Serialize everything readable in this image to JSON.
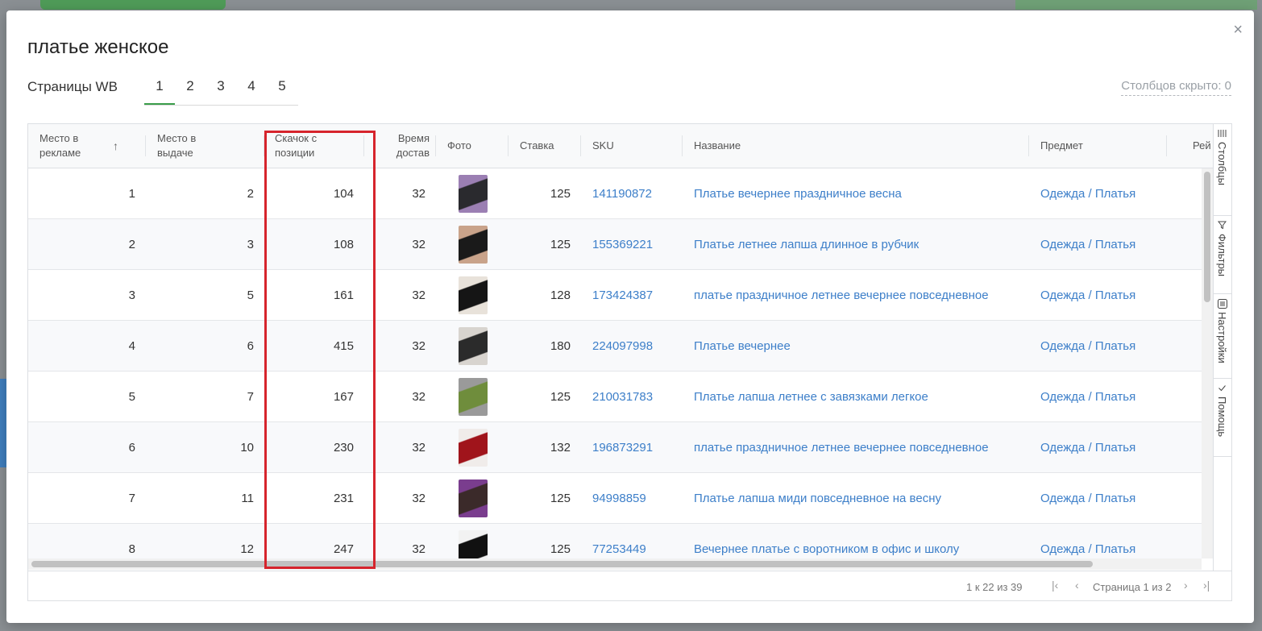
{
  "modal": {
    "title": "платье женское",
    "close_icon": "×",
    "pages_label": "Страницы WB",
    "tabs": [
      "1",
      "2",
      "3",
      "4",
      "5"
    ],
    "active_tab": "1",
    "hidden_columns": "Столбцов скрыто: 0"
  },
  "grid": {
    "columns": [
      "Место в рекламе",
      "Место в выдаче",
      "Скачок с позиции",
      "Время достав",
      "Фото",
      "Ставка",
      "SKU",
      "Название",
      "Предмет",
      "Рей"
    ],
    "sort_icon": "↑",
    "rows": [
      {
        "ad": "1",
        "pos": "2",
        "jump": "104",
        "time": "32",
        "rate": "125",
        "sku": "141190872",
        "name": "Платье вечернее праздничное весна",
        "subject": "Одежда / Платья",
        "photo_colors": [
          "#2a2a2e",
          "#9b7fb3"
        ]
      },
      {
        "ad": "2",
        "pos": "3",
        "jump": "108",
        "time": "32",
        "rate": "125",
        "sku": "155369221",
        "name": "Платье летнее лапша длинное в рубчик",
        "subject": "Одежда / Платья",
        "photo_colors": [
          "#1a1a1a",
          "#c9a38a"
        ]
      },
      {
        "ad": "3",
        "pos": "5",
        "jump": "161",
        "time": "32",
        "rate": "128",
        "sku": "173424387",
        "name": "платье праздничное летнее вечернее повседневное",
        "subject": "Одежда / Платья",
        "photo_colors": [
          "#151515",
          "#e8e2da"
        ]
      },
      {
        "ad": "4",
        "pos": "6",
        "jump": "415",
        "time": "32",
        "rate": "180",
        "sku": "224097998",
        "name": "Платье вечернее",
        "subject": "Одежда / Платья",
        "photo_colors": [
          "#2b2b2b",
          "#d8d4cf"
        ]
      },
      {
        "ad": "5",
        "pos": "7",
        "jump": "167",
        "time": "32",
        "rate": "125",
        "sku": "210031783",
        "name": "Платье лапша летнее с завязками легкое",
        "subject": "Одежда / Платья",
        "photo_colors": [
          "#6f8d3c",
          "#9a9a9a"
        ]
      },
      {
        "ad": "6",
        "pos": "10",
        "jump": "230",
        "time": "32",
        "rate": "132",
        "sku": "196873291",
        "name": "платье праздничное летнее вечернее повседневное",
        "subject": "Одежда / Платья",
        "photo_colors": [
          "#a0141b",
          "#f0ecea"
        ]
      },
      {
        "ad": "7",
        "pos": "11",
        "jump": "231",
        "time": "32",
        "rate": "125",
        "sku": "94998859",
        "name": "Платье лапша миди повседневное на весну",
        "subject": "Одежда / Платья",
        "photo_colors": [
          "#3b2a2a",
          "#7a3d8e"
        ]
      },
      {
        "ad": "8",
        "pos": "12",
        "jump": "247",
        "time": "32",
        "rate": "125",
        "sku": "77253449",
        "name": "Вечернее платье с воротником в офис и школу",
        "subject": "Одежда / Платья",
        "photo_colors": [
          "#111111",
          "#f2f2f2"
        ]
      }
    ]
  },
  "side_panel": [
    {
      "label": "Столбцы",
      "icon": "columns-icon"
    },
    {
      "label": "Фильтры",
      "icon": "filter-icon"
    },
    {
      "label": "Настройки",
      "icon": "settings-icon"
    },
    {
      "label": "Помощь",
      "icon": "help-icon"
    }
  ],
  "footer": {
    "range": "1 к 22 из 39",
    "page_text": "Страница 1 из 2",
    "first_icon": "|‹",
    "prev_icon": "‹",
    "next_icon": "›",
    "last_icon": "›|"
  },
  "colors": {
    "link": "#3d7fc9",
    "accent_green": "#3a9d4a",
    "highlight_red": "#d6242c"
  }
}
